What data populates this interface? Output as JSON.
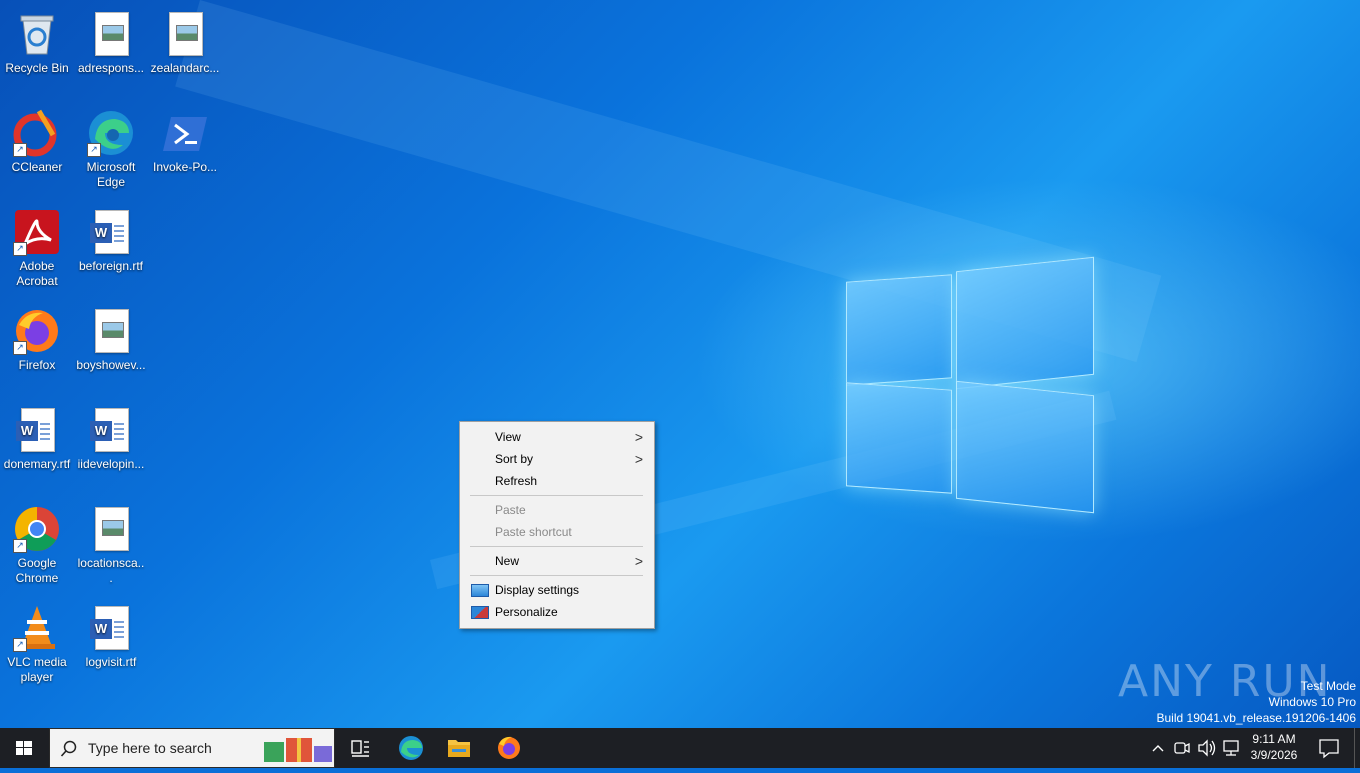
{
  "desktop": {
    "icons": [
      {
        "label": "Recycle Bin"
      },
      {
        "label": "adrespons..."
      },
      {
        "label": "zealandarc..."
      },
      {
        "label": "CCleaner"
      },
      {
        "label": "Microsoft Edge"
      },
      {
        "label": "Invoke-Po..."
      },
      {
        "label": "Adobe Acrobat"
      },
      {
        "label": "beforeign.rtf"
      },
      {
        "label": "Firefox"
      },
      {
        "label": "boyshowev..."
      },
      {
        "label": "donemary.rtf"
      },
      {
        "label": "iidevelopin..."
      },
      {
        "label": "Google Chrome"
      },
      {
        "label": "locationsca..."
      },
      {
        "label": "VLC media player"
      },
      {
        "label": "logvisit.rtf"
      }
    ]
  },
  "context_menu": {
    "items": [
      {
        "label": "View"
      },
      {
        "label": "Sort by"
      },
      {
        "label": "Refresh"
      },
      {
        "label": "Paste"
      },
      {
        "label": "Paste shortcut"
      },
      {
        "label": "New"
      },
      {
        "label": "Display settings"
      },
      {
        "label": "Personalize"
      }
    ]
  },
  "watermark": {
    "brand": "ANY RUN",
    "test_mode": "Test Mode",
    "edition": "Windows 10 Pro",
    "build": "Build 19041.vb_release.191206-1406"
  },
  "taskbar": {
    "search_placeholder": "Type here to search",
    "clock_time": "9:11 AM",
    "clock_date": "3/9/2026"
  },
  "colors": {
    "accent": "#0a73dc",
    "taskbar": "#1d1f24",
    "menu_bg": "#f2f2f2"
  }
}
